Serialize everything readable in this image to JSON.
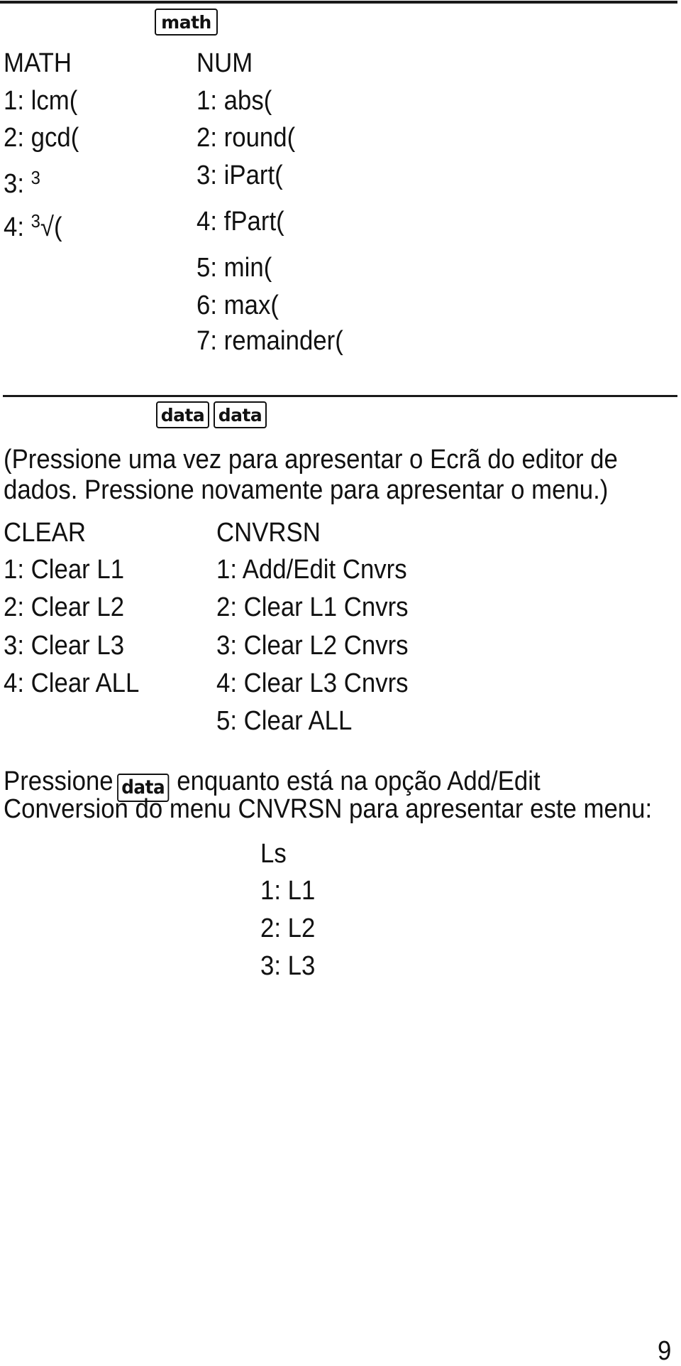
{
  "section_math": {
    "key_label": "math",
    "left_menu": {
      "title": "MATH",
      "items": [
        {
          "num": "1:",
          "label": "lcm("
        },
        {
          "num": "2:",
          "label": "gcd("
        },
        {
          "num": "3:",
          "superscript": "3",
          "label": ""
        },
        {
          "num": "4:",
          "superscript": "3",
          "root_symbol": "√",
          "label": "("
        }
      ]
    },
    "right_menu": {
      "title": "NUM",
      "items": [
        {
          "num": "1:",
          "label": "abs("
        },
        {
          "num": "2:",
          "label": "round("
        },
        {
          "num": "3:",
          "label": "iPart("
        },
        {
          "num": "4:",
          "label": "fPart("
        },
        {
          "num": "5:",
          "label": "min("
        },
        {
          "num": "6:",
          "label": "max("
        },
        {
          "num": "7:",
          "label": "remainder("
        }
      ]
    }
  },
  "section_data": {
    "key_labels": [
      "data",
      "data"
    ],
    "description": [
      "(Pressione uma vez para apresentar o Ecrã do editor de",
      "dados. Pressione novamente para apresentar o menu.)"
    ],
    "left_menu": {
      "title": "CLEAR",
      "items": [
        "1: Clear L1",
        "2: Clear L2",
        "3: Clear L3",
        "4: Clear ALL"
      ]
    },
    "right_menu": {
      "title": "CNVRSN",
      "items": [
        "1: Add/Edit Cnvrs",
        "2: Clear L1 Cnvrs",
        "3: Clear L2 Cnvrs",
        "4: Clear L3 Cnvrs",
        "5: Clear ALL"
      ]
    },
    "instruction": {
      "before_key": "Pressione",
      "key_label": "data",
      "after_key": "enquanto está na opção Add/Edit",
      "line2": "Conversion do menu CNVRSN para apresentar este menu:"
    },
    "ls_menu": {
      "title": "Ls",
      "items": [
        "1: L1",
        "2: L2",
        "3: L3"
      ]
    }
  },
  "page_number": "9"
}
